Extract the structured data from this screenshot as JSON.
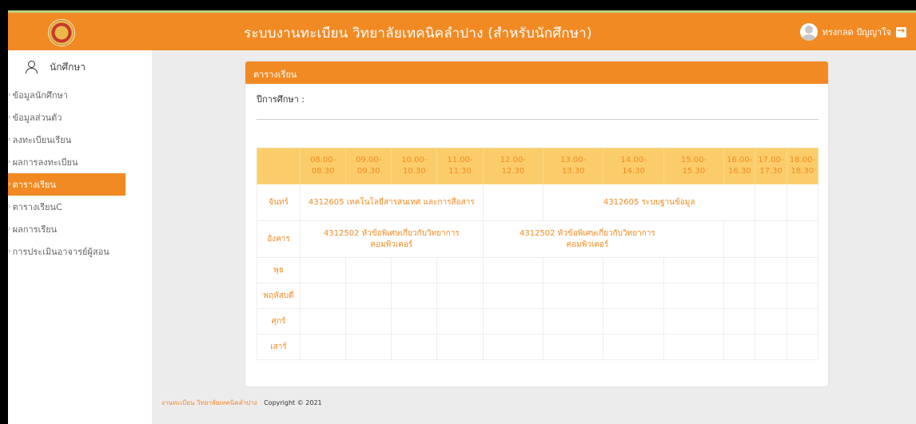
{
  "header": {
    "title": "ระบบงานทะเบียน วิทยาลัยเทคนิคลำปาง (สำหรับนักศึกษา)",
    "user_name": "ทรงกลด ปัญญาใจ",
    "logo_icon": "college-seal",
    "logout_icon": "logout-icon"
  },
  "sidebar": {
    "heading": "นักศึกษา",
    "items": [
      {
        "label": "ข้อมูลนักศึกษา",
        "active": false
      },
      {
        "label": "ข้อมูลส่วนตัว",
        "active": false
      },
      {
        "label": "ลงทะเบียนเรียน",
        "active": false
      },
      {
        "label": "ผลการลงทะเบียน",
        "active": false
      },
      {
        "label": "ตารางเรียน",
        "active": true
      },
      {
        "label": "ตารางเรียนC",
        "active": false
      },
      {
        "label": "ผลการเรียน",
        "active": false
      },
      {
        "label": "การประเมินอาจารย์ผู้สอน",
        "active": false
      }
    ]
  },
  "card": {
    "title": "ตารางเรียน",
    "year_label": "ปีการศึกษา :"
  },
  "timetable": {
    "time_headers": [
      "08.00-\n08.30",
      "09.00-\n09.30",
      "10.00-\n10.30",
      "11.00-\n11.30",
      "12.00-\n12.30",
      "13.00-\n13.30",
      "14.00-\n14.30",
      "15.00-\n15.30",
      "16.00-\n16.30",
      "17.00-\n17.30",
      "18.00-\n18.30"
    ],
    "days": [
      {
        "name": "จันทร์",
        "blocks": [
          {
            "start": 0,
            "span": 4,
            "text": "4312605 เทคโนโลยีสารสนเทศ และการสื่อสาร"
          },
          {
            "start": 4,
            "span": 1,
            "text": ""
          },
          {
            "start": 5,
            "span": 4,
            "text": "4312605 ระบบฐานข้อมูล"
          },
          {
            "start": 9,
            "span": 1,
            "text": ""
          },
          {
            "start": 10,
            "span": 1,
            "text": ""
          }
        ]
      },
      {
        "name": "อังคาร",
        "blocks": [
          {
            "start": 0,
            "span": 4,
            "text": "4312502 หัวข้อพิเศษเกี่ยวกับวิทยาการคอมพิวเตอร์"
          },
          {
            "start": 4,
            "span": 4,
            "text": "4312502 หัวข้อพิเศษเกี่ยวกับวิทยาการคอมพิวเตอร์"
          },
          {
            "start": 8,
            "span": 1,
            "text": ""
          },
          {
            "start": 9,
            "span": 1,
            "text": ""
          },
          {
            "start": 10,
            "span": 1,
            "text": ""
          }
        ]
      },
      {
        "name": "พุธ",
        "blocks": []
      },
      {
        "name": "พฤหัสบดี",
        "blocks": []
      },
      {
        "name": "ศุกร์",
        "blocks": []
      },
      {
        "name": "เสาร์",
        "blocks": []
      }
    ]
  },
  "footer": {
    "link_text": "งานทะเบียน วิทยาลัยเทคนิคลำปาง",
    "copyright": "Copyright © 2021"
  },
  "colors": {
    "accent": "#f28a23",
    "header_cell": "#fbcd6a"
  }
}
